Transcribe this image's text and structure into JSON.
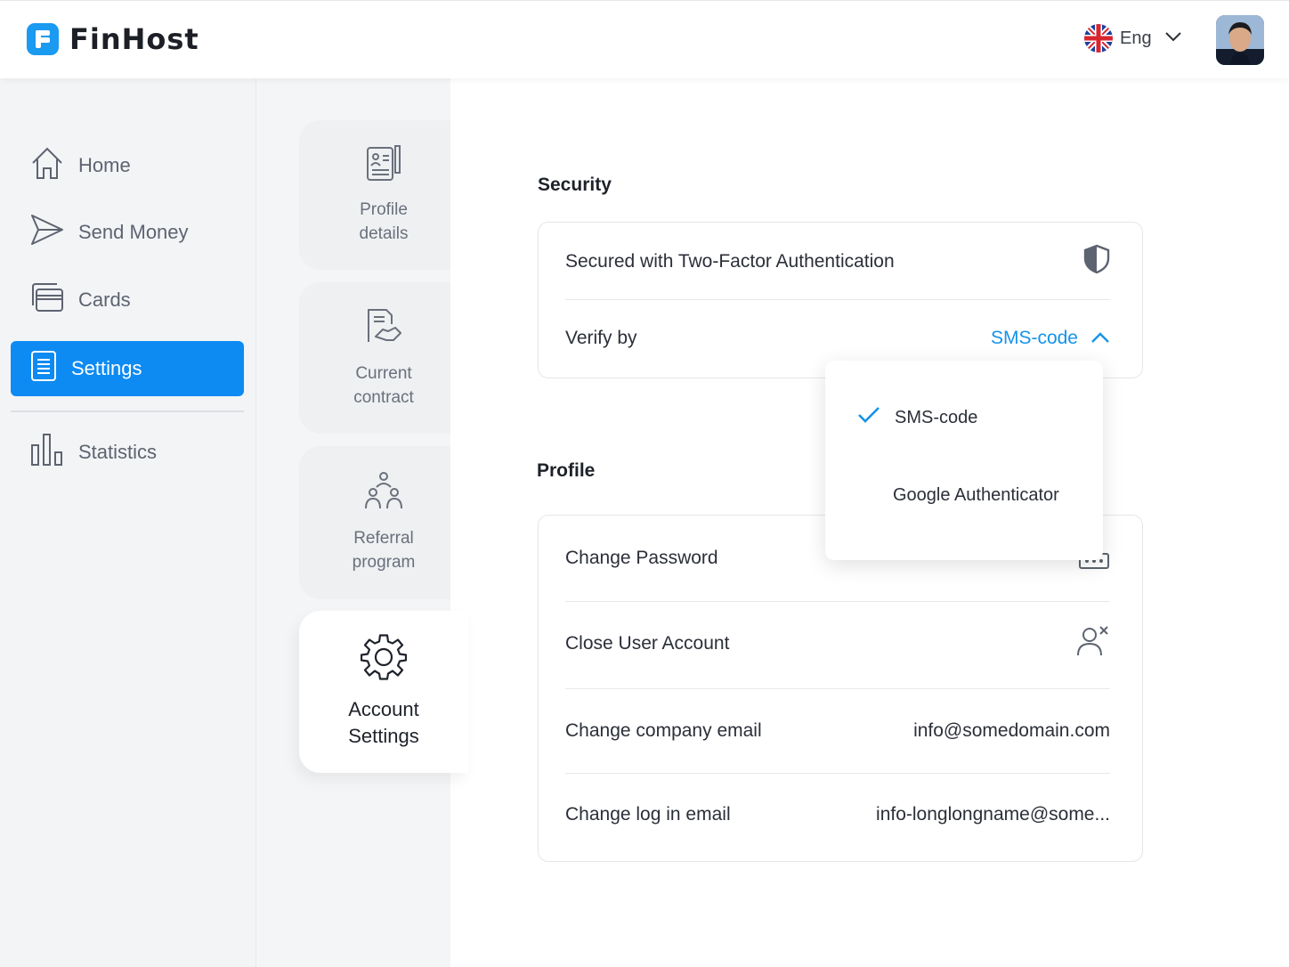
{
  "brand": {
    "name": "FinHost"
  },
  "header": {
    "language": "Eng"
  },
  "sidebar": {
    "items": [
      {
        "label": "Home",
        "icon": "home-icon"
      },
      {
        "label": "Send Money",
        "icon": "send-icon"
      },
      {
        "label": "Cards",
        "icon": "cards-icon"
      },
      {
        "label": "Settings",
        "icon": "settings-doc-icon",
        "active": true
      },
      {
        "label": "Statistics",
        "icon": "bar-chart-icon"
      }
    ]
  },
  "settings_tabs": [
    {
      "line1": "Profile",
      "line2": "details",
      "icon": "profile-document-icon"
    },
    {
      "line1": "Current",
      "line2": "contract",
      "icon": "contract-handshake-icon"
    },
    {
      "line1": "Referral",
      "line2": "program",
      "icon": "referral-people-icon"
    },
    {
      "line1": "Account",
      "line2": "Settings",
      "icon": "gear-icon",
      "active": true
    }
  ],
  "security": {
    "title": "Security",
    "two_factor_label": "Secured with Two-Factor Authentication",
    "verify_label": "Verify by",
    "verify_value": "SMS-code"
  },
  "verify_dropdown": {
    "options": [
      "SMS-code",
      "Google Authenticator"
    ],
    "selected": "SMS-code"
  },
  "profile": {
    "title": "Profile",
    "rows": [
      {
        "label": "Change Password",
        "value": ""
      },
      {
        "label": "Close User Account",
        "value": ""
      },
      {
        "label": "Change company email",
        "value": "info@somedomain.com"
      },
      {
        "label": "Change log in email",
        "value": "info-longlongname@some..."
      }
    ]
  },
  "colors": {
    "accent": "#0d8bf2",
    "link": "#1593ea"
  }
}
